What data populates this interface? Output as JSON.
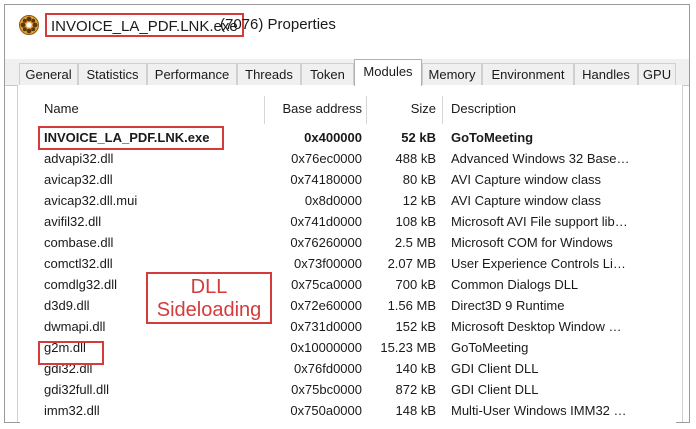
{
  "window": {
    "title_exe": "INVOICE_LA_PDF.LNK.exe",
    "title_rest": "(7076) Properties",
    "icon": "process-explorer-gear-icon"
  },
  "tabs": [
    "General",
    "Statistics",
    "Performance",
    "Threads",
    "Token",
    "Modules",
    "Memory",
    "Environment",
    "Handles",
    "GPU"
  ],
  "active_tab": "Modules",
  "columns": {
    "name": "Name",
    "base": "Base address",
    "size": "Size",
    "desc": "Description"
  },
  "rows": [
    {
      "name": "INVOICE_LA_PDF.LNK.exe",
      "base": "0x400000",
      "size": "52 kB",
      "desc": "GoToMeeting"
    },
    {
      "name": "advapi32.dll",
      "base": "0x76ec0000",
      "size": "488 kB",
      "desc": "Advanced Windows 32 Base…"
    },
    {
      "name": "avicap32.dll",
      "base": "0x74180000",
      "size": "80 kB",
      "desc": "AVI Capture window class"
    },
    {
      "name": "avicap32.dll.mui",
      "base": "0x8d0000",
      "size": "12 kB",
      "desc": "AVI Capture window class"
    },
    {
      "name": "avifil32.dll",
      "base": "0x741d0000",
      "size": "108 kB",
      "desc": "Microsoft AVI File support lib…"
    },
    {
      "name": "combase.dll",
      "base": "0x76260000",
      "size": "2.5 MB",
      "desc": "Microsoft COM for Windows"
    },
    {
      "name": "comctl32.dll",
      "base": "0x73f00000",
      "size": "2.07 MB",
      "desc": "User Experience Controls Li…"
    },
    {
      "name": "comdlg32.dll",
      "base": "0x75ca0000",
      "size": "700 kB",
      "desc": "Common Dialogs DLL"
    },
    {
      "name": "d3d9.dll",
      "base": "0x72e60000",
      "size": "1.56 MB",
      "desc": "Direct3D 9 Runtime"
    },
    {
      "name": "dwmapi.dll",
      "base": "0x731d0000",
      "size": "152 kB",
      "desc": "Microsoft Desktop Window …"
    },
    {
      "name": "g2m.dll",
      "base": "0x10000000",
      "size": "15.23 MB",
      "desc": "GoToMeeting"
    },
    {
      "name": "gdi32.dll",
      "base": "0x76fd0000",
      "size": "140 kB",
      "desc": "GDI Client DLL"
    },
    {
      "name": "gdi32full.dll",
      "base": "0x75bc0000",
      "size": "872 kB",
      "desc": "GDI Client DLL"
    },
    {
      "name": "imm32.dll",
      "base": "0x750a0000",
      "size": "148 kB",
      "desc": "Multi-User Windows IMM32 …"
    }
  ],
  "annotation": {
    "line1": "DLL",
    "line2": "Sideloading"
  },
  "colors": {
    "highlight": "#d43b3b",
    "tab_bg": "#f0f0f0"
  }
}
